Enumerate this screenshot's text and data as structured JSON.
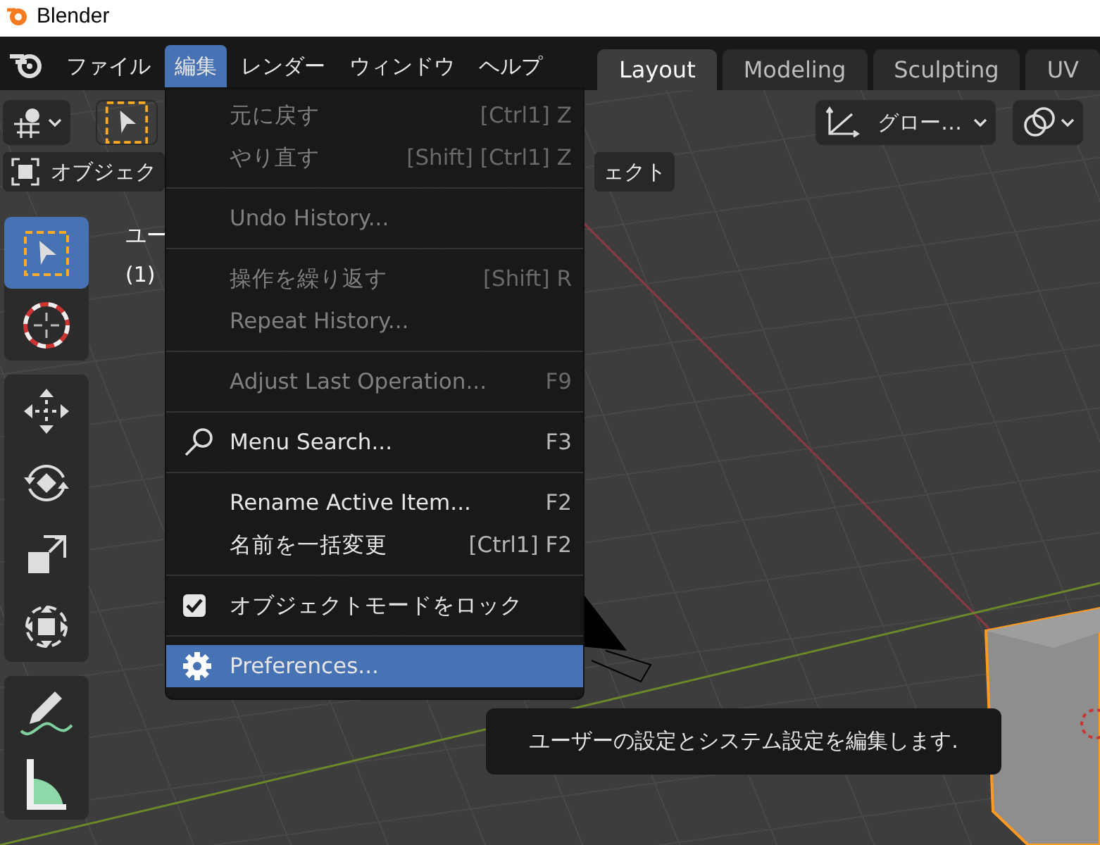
{
  "window": {
    "title": "Blender"
  },
  "menubar": [
    {
      "label": "ファイル",
      "selected": false
    },
    {
      "label": "編集",
      "selected": true
    },
    {
      "label": "レンダー",
      "selected": false
    },
    {
      "label": "ウィンドウ",
      "selected": false
    },
    {
      "label": "ヘルプ",
      "selected": false
    }
  ],
  "workspaces": [
    {
      "label": "Layout",
      "selected": true
    },
    {
      "label": "Modeling",
      "selected": false
    },
    {
      "label": "Sculpting",
      "selected": false
    },
    {
      "label": "UV",
      "selected": false
    }
  ],
  "header": {
    "orientation": "グロー…"
  },
  "mode_row": {
    "mode": "オブジェク",
    "menus": [
      "ェクト"
    ]
  },
  "viewport": {
    "overlay_lines": [
      "ユー",
      "(1)"
    ]
  },
  "tools": [
    {
      "kind": "select",
      "selected": true
    },
    {
      "kind": "cursor",
      "selected": false
    },
    {
      "kind": "move",
      "selected": false
    },
    {
      "kind": "rotate",
      "selected": false
    },
    {
      "kind": "scale",
      "selected": false
    },
    {
      "kind": "transform",
      "selected": false
    },
    {
      "kind": "annotate",
      "selected": false
    },
    {
      "kind": "measure",
      "selected": false
    }
  ],
  "edit_menu": [
    {
      "kind": "item",
      "label": "元に戻す",
      "shortcut": "[Ctrl1] Z",
      "disabled": true,
      "selected": false
    },
    {
      "kind": "item",
      "label": "やり直す",
      "shortcut": "[Shift] [Ctrl1] Z",
      "disabled": true,
      "selected": false
    },
    {
      "kind": "separator"
    },
    {
      "kind": "item",
      "label": "Undo History...",
      "disabled": true,
      "selected": false
    },
    {
      "kind": "separator"
    },
    {
      "kind": "item",
      "label": "操作を繰り返す",
      "shortcut": "[Shift] R",
      "disabled": true,
      "selected": false
    },
    {
      "kind": "item",
      "label": "Repeat History...",
      "disabled": true,
      "selected": false
    },
    {
      "kind": "separator"
    },
    {
      "kind": "item",
      "label": "Adjust Last Operation...",
      "shortcut": "F9",
      "disabled": true,
      "selected": false
    },
    {
      "kind": "separator"
    },
    {
      "kind": "search",
      "label": "Menu Search...",
      "shortcut": "F3",
      "disabled": false,
      "selected": false
    },
    {
      "kind": "separator"
    },
    {
      "kind": "item",
      "label": "Rename Active Item...",
      "shortcut": "F2",
      "disabled": false,
      "selected": false
    },
    {
      "kind": "item",
      "label": "名前を一括変更",
      "shortcut": "[Ctrl1] F2",
      "disabled": false,
      "selected": false
    },
    {
      "kind": "separator"
    },
    {
      "kind": "checkbox",
      "label": "オブジェクトモードをロック",
      "checked": true,
      "disabled": false,
      "selected": false
    },
    {
      "kind": "separator"
    },
    {
      "kind": "settings",
      "label": "Preferences...",
      "disabled": false,
      "selected": true
    }
  ],
  "tooltip": {
    "text": "ユーザーの設定とシステム設定を編集します."
  }
}
